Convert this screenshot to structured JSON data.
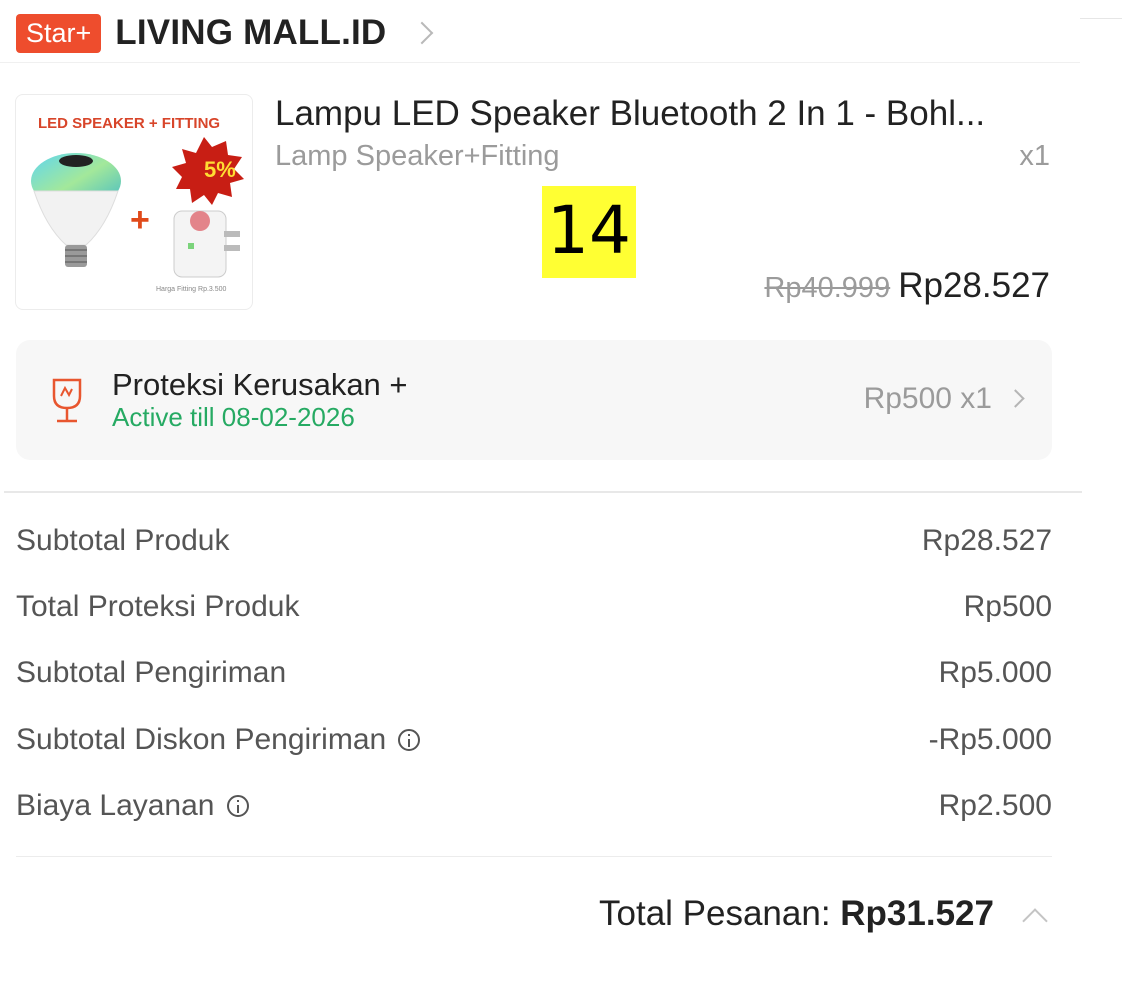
{
  "shop": {
    "badge": "Star+",
    "name": "LIVING MALL.ID"
  },
  "product": {
    "title": "Lampu LED Speaker Bluetooth 2 In 1 - Bohl...",
    "variant": "Lamp Speaker+Fitting",
    "quantity": "x1",
    "original_price": "Rp40.999",
    "price": "Rp28.527",
    "image": {
      "banner": "LED SPEAKER + FITTING",
      "plus": "+",
      "discount": "5%",
      "caption": "Harga Fitting Rp.3.500"
    }
  },
  "annotation": {
    "label": "14"
  },
  "protection": {
    "title": "Proteksi Kerusakan +",
    "active": "Active till 08-02-2026",
    "price": "Rp500 x1"
  },
  "summary": {
    "rows": [
      {
        "label": "Subtotal Produk",
        "value": "Rp28.527"
      },
      {
        "label": "Total Proteksi Produk",
        "value": "Rp500"
      },
      {
        "label": "Subtotal Pengiriman",
        "value": "Rp5.000"
      },
      {
        "label": "Subtotal Diskon Pengiriman",
        "value": "-Rp5.000"
      },
      {
        "label": "Biaya Layanan",
        "value": "Rp2.500"
      }
    ],
    "total_label": "Total Pesanan: ",
    "total_value": "Rp31.527"
  },
  "colors": {
    "brand": "#ee4d2d",
    "green": "#26aa63",
    "highlight": "#ffff33"
  }
}
